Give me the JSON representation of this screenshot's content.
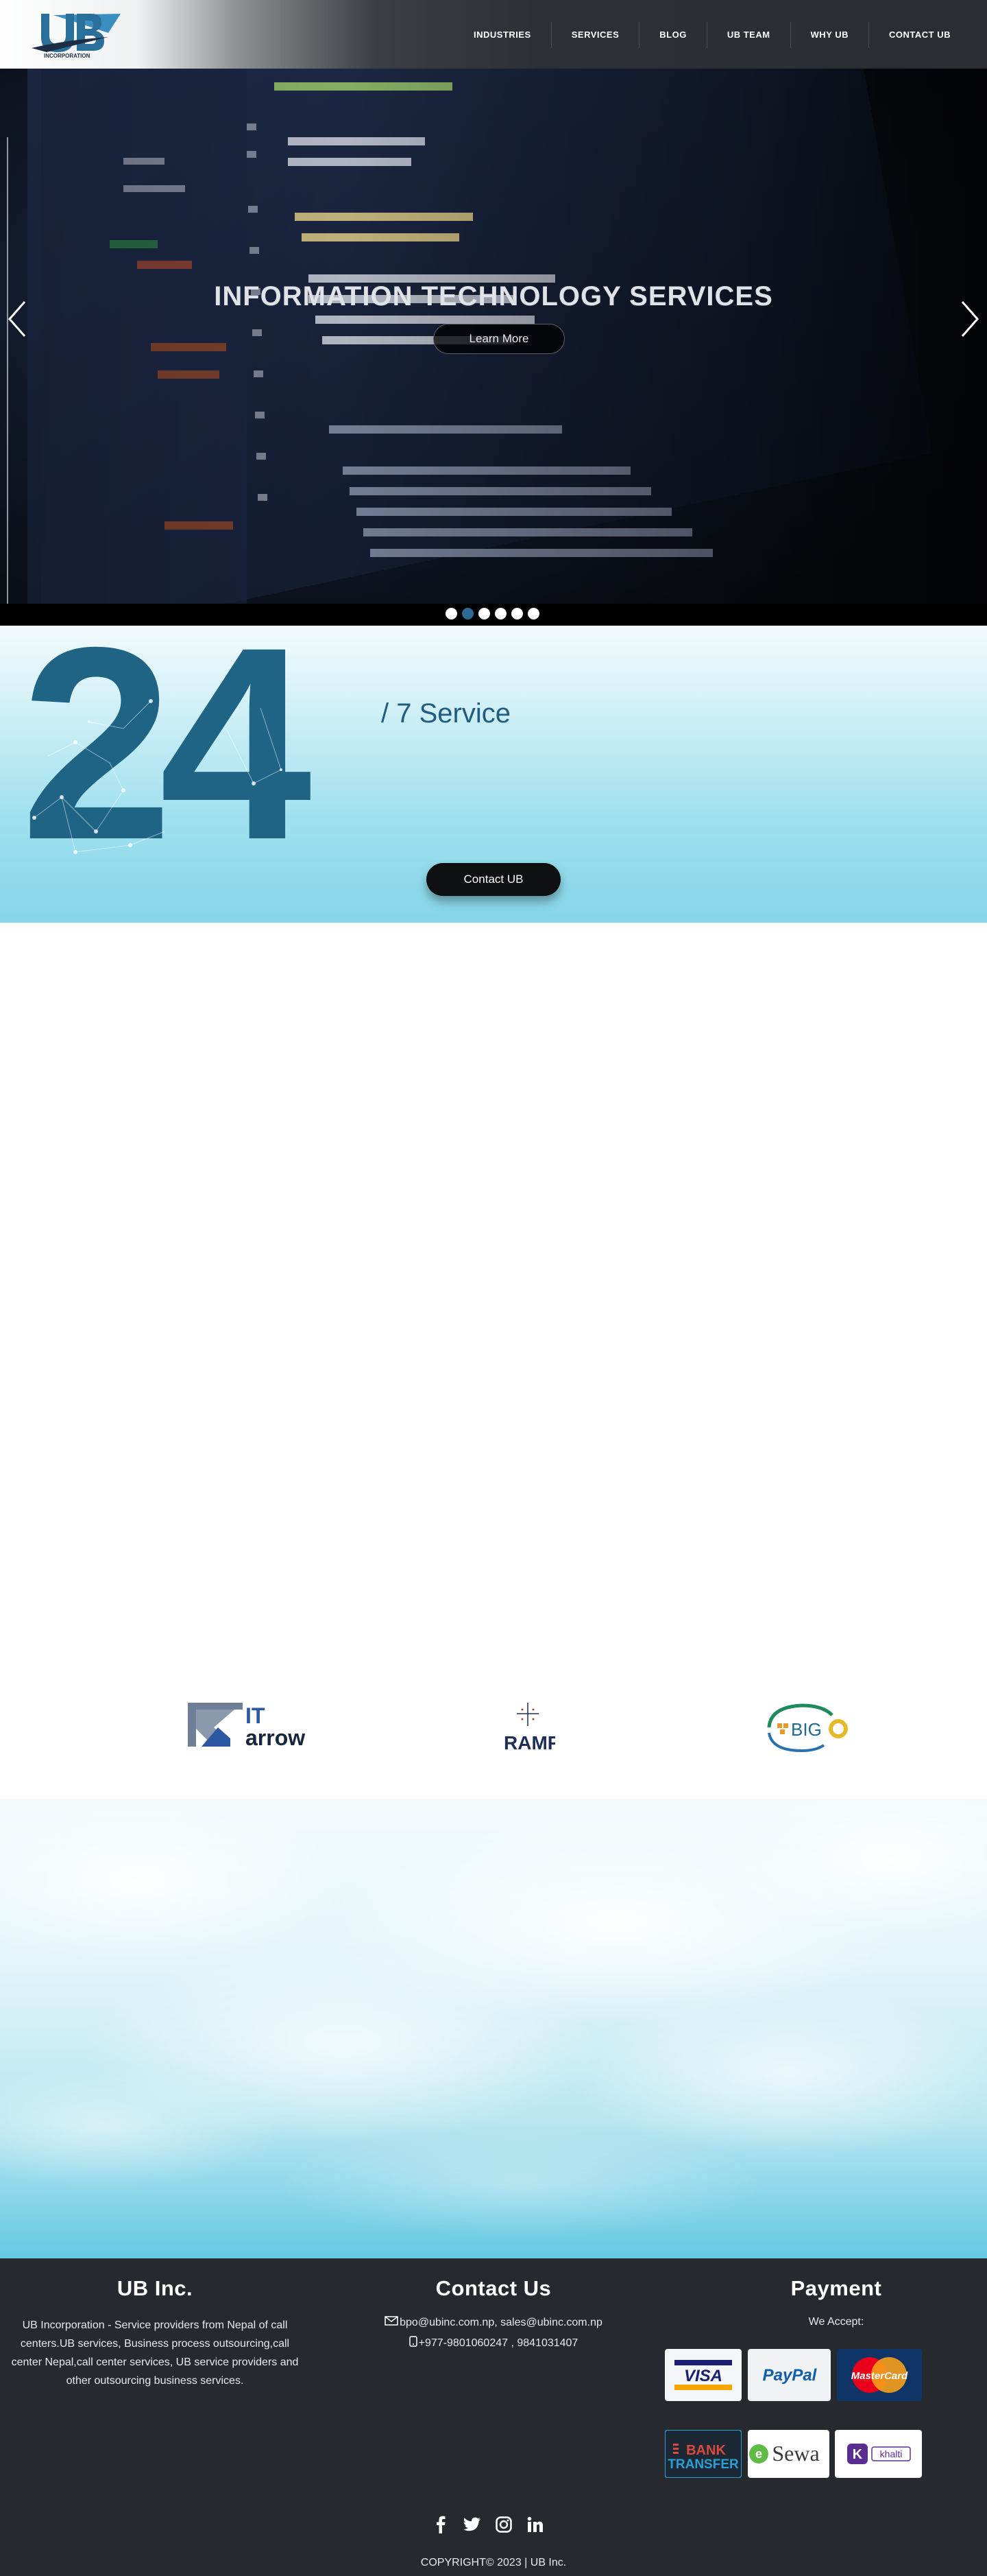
{
  "brand": {
    "logo_text": "UB",
    "logo_subtext": "INCORPORATION",
    "logo_color": "#2c7fa8"
  },
  "nav": {
    "items": [
      {
        "label": "INDUSTRIES"
      },
      {
        "label": "SERVICES"
      },
      {
        "label": "BLOG"
      },
      {
        "label": "UB TEAM"
      },
      {
        "label": "WHY UB"
      },
      {
        "label": "CONTACT UB"
      }
    ]
  },
  "hero": {
    "title": "INFORMATION TECHNOLOGY SERVICES",
    "button_label": "Learn More",
    "prev_icon": "chevron-left-icon",
    "next_icon": "chevron-right-icon",
    "slide_count": 6,
    "active_slide": 2
  },
  "service": {
    "big_number": "24",
    "text": "/ 7 Service",
    "button_label": "Contact UB",
    "accent_color": "#1f5c80"
  },
  "partners": [
    {
      "name": "IT arrow",
      "part1": "IT",
      "part2": "arrow"
    },
    {
      "name": "RAMP",
      "text": "RAMP"
    },
    {
      "name": "BIG O",
      "text": "BIG"
    }
  ],
  "footer": {
    "about": {
      "title": "UB Inc.",
      "text": "UB Incorporation - Service providers from Nepal of call centers.UB services, Business process outsourcing,call center Nepal,call center services, UB service providers and other outsourcing business services."
    },
    "contact": {
      "title": "Contact Us",
      "email": "bpo@ubinc.com.np, sales@ubinc.com.np",
      "phone": "+977-9801060247 , 9841031407"
    },
    "payment": {
      "title": "Payment",
      "accept_label": "We Accept:",
      "methods": [
        {
          "name": "VISA",
          "color": "#1a1f71"
        },
        {
          "name": "PayPal",
          "color": "#003087"
        },
        {
          "name": "MasterCard",
          "color": "#eb001b"
        },
        {
          "name": "BANK TRANSFER",
          "line1": "BANK",
          "line2": "TRANSFER",
          "color": "#2a9fd6"
        },
        {
          "name": "eSewa",
          "text": "Sewa",
          "color": "#60bb46"
        },
        {
          "name": "khalti",
          "text": "khalti",
          "color": "#5c2d91"
        }
      ]
    },
    "socials": [
      {
        "icon": "facebook-icon"
      },
      {
        "icon": "twitter-icon"
      },
      {
        "icon": "instagram-icon"
      },
      {
        "icon": "linkedin-icon"
      }
    ],
    "copyright": "COPYRIGHT© 2023  | UB Inc."
  }
}
